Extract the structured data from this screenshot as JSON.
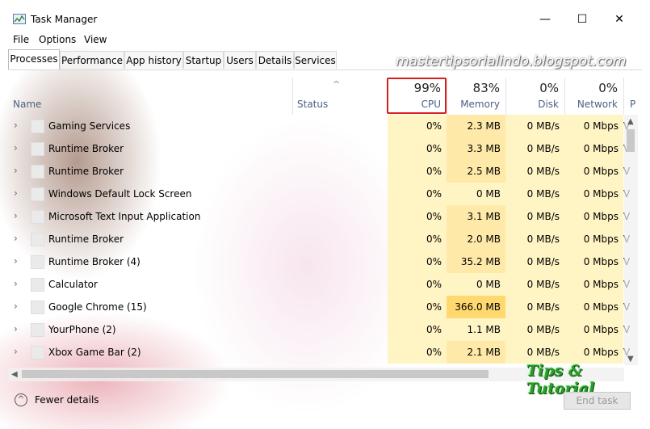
{
  "window": {
    "title": "Task Manager",
    "minimize": "—",
    "maximize": "☐",
    "close": "✕"
  },
  "menu": [
    "File",
    "Options",
    "View"
  ],
  "tabs": [
    "Processes",
    "Performance",
    "App history",
    "Startup",
    "Users",
    "Details",
    "Services"
  ],
  "active_tab": "Processes",
  "watermark": "mastertipsorialindo.blogspot.com",
  "logo_text": "Tips & Tutorial",
  "columns": {
    "name": {
      "label": "Name"
    },
    "status": {
      "label": "Status"
    },
    "cpu": {
      "label": "CPU",
      "pct": "99%"
    },
    "memory": {
      "label": "Memory",
      "pct": "83%"
    },
    "disk": {
      "label": "Disk",
      "pct": "0%"
    },
    "network": {
      "label": "Network",
      "pct": "0%"
    },
    "power": {
      "label": "P"
    }
  },
  "rows": [
    {
      "name": "Gaming Services",
      "cpu": "0%",
      "memory": "2.3 MB",
      "disk": "0 MB/s",
      "network": "0 Mbps",
      "power": "Ve"
    },
    {
      "name": "Runtime Broker",
      "cpu": "0%",
      "memory": "3.3 MB",
      "disk": "0 MB/s",
      "network": "0 Mbps",
      "power": "Ve"
    },
    {
      "name": "Runtime Broker",
      "cpu": "0%",
      "memory": "2.5 MB",
      "disk": "0 MB/s",
      "network": "0 Mbps",
      "power": "Ve"
    },
    {
      "name": "Windows Default Lock Screen",
      "cpu": "0%",
      "memory": "0 MB",
      "disk": "0 MB/s",
      "network": "0 Mbps",
      "power": "Ve"
    },
    {
      "name": "Microsoft Text Input Application",
      "cpu": "0%",
      "memory": "3.1 MB",
      "disk": "0 MB/s",
      "network": "0 Mbps",
      "power": "Ve"
    },
    {
      "name": "Runtime Broker",
      "cpu": "0%",
      "memory": "2.0 MB",
      "disk": "0 MB/s",
      "network": "0 Mbps",
      "power": "Ve"
    },
    {
      "name": "Runtime Broker (4)",
      "cpu": "0%",
      "memory": "35.2 MB",
      "disk": "0 MB/s",
      "network": "0 Mbps",
      "power": "Ve"
    },
    {
      "name": "Calculator",
      "cpu": "0%",
      "memory": "0 MB",
      "disk": "0 MB/s",
      "network": "0 Mbps",
      "power": "Ve"
    },
    {
      "name": "Google Chrome (15)",
      "cpu": "0%",
      "memory": "366.0 MB",
      "disk": "0 MB/s",
      "network": "0 Mbps",
      "power": "Ve"
    },
    {
      "name": "YourPhone (2)",
      "cpu": "0%",
      "memory": "1.1 MB",
      "disk": "0 MB/s",
      "network": "0 Mbps",
      "power": "Ve"
    },
    {
      "name": "Xbox Game Bar (2)",
      "cpu": "0%",
      "memory": "2.1 MB",
      "disk": "0 MB/s",
      "network": "0 Mbps",
      "power": "Ve"
    }
  ],
  "footer": {
    "fewer_details": "Fewer details",
    "end_task": "End task"
  },
  "colors": {
    "cpu_bg": "#fff4c4",
    "mem_light": "#fff4c4",
    "mem_mid": "#ffe9a8",
    "mem_high": "#ffd86f",
    "highlight": "#d91e1e"
  }
}
